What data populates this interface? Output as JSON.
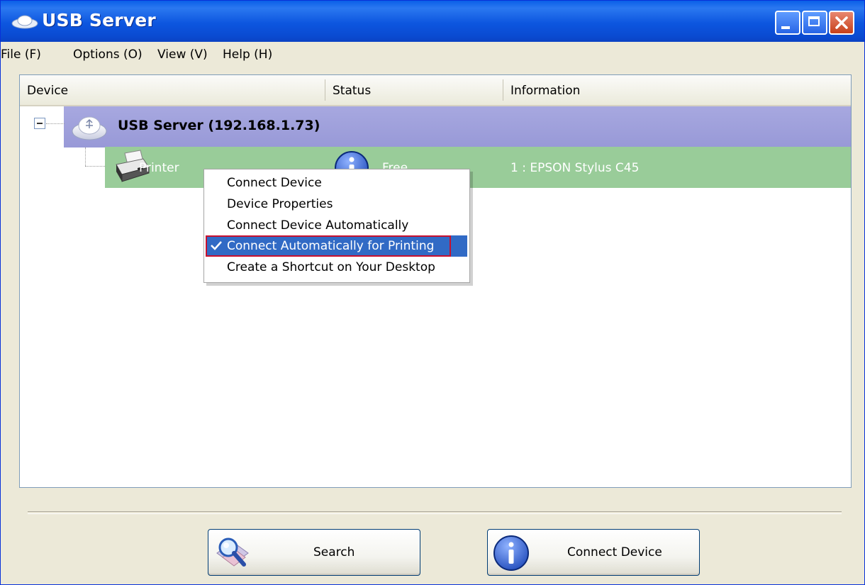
{
  "window": {
    "title": "USB Server",
    "controls": {
      "minimize": "minimize-icon",
      "maximize": "maximize-icon",
      "close": "close-icon"
    }
  },
  "menubar": {
    "items": [
      {
        "label": "File (F)"
      },
      {
        "label": "Options (O)"
      },
      {
        "label": "View (V)"
      },
      {
        "label": "Help (H)"
      }
    ]
  },
  "list": {
    "columns": [
      "Device",
      "Status",
      "Information"
    ],
    "server": {
      "label": "USB Server  (192.168.1.73)",
      "expanded": true
    },
    "devices": [
      {
        "name": "Printer",
        "status": "Free",
        "information": "1 : EPSON Stylus C45"
      }
    ]
  },
  "context_menu": {
    "items": [
      {
        "label": "Connect Device",
        "checked": false
      },
      {
        "label": "Device Properties",
        "checked": false
      },
      {
        "label": "Connect Device Automatically",
        "checked": false
      },
      {
        "label": "Connect Automatically for Printing",
        "checked": true,
        "highlighted": true
      },
      {
        "label": "Create a Shortcut on Your Desktop",
        "checked": false
      }
    ]
  },
  "buttons": {
    "search": "Search",
    "connect": "Connect Device"
  },
  "colors": {
    "titlebar": "#0a5fe8",
    "server_row": "#9e9fdb",
    "device_row": "#99cc99",
    "menu_highlight": "#316ac5",
    "highlight_border": "#c8102e"
  }
}
